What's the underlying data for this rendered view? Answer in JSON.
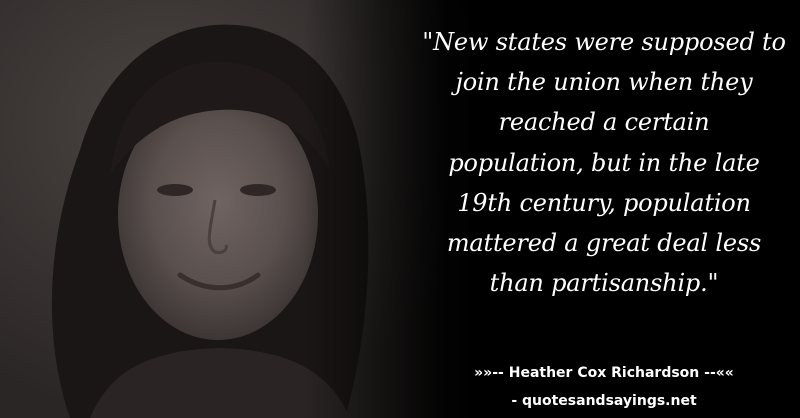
{
  "quote": {
    "lines": [
      "\"New states were supposed to",
      "join the union when they",
      "reached a certain",
      "population, but in the late",
      "19th century, population",
      "mattered a great deal less",
      "than partisanship.\""
    ]
  },
  "attribution": {
    "prefix": "»»-- ",
    "author": "Heather Cox Richardson",
    "suffix": " --««"
  },
  "source": {
    "text": "- quotesandsayings.net"
  },
  "colors": {
    "text": "#ffffff",
    "background": "#000000"
  }
}
